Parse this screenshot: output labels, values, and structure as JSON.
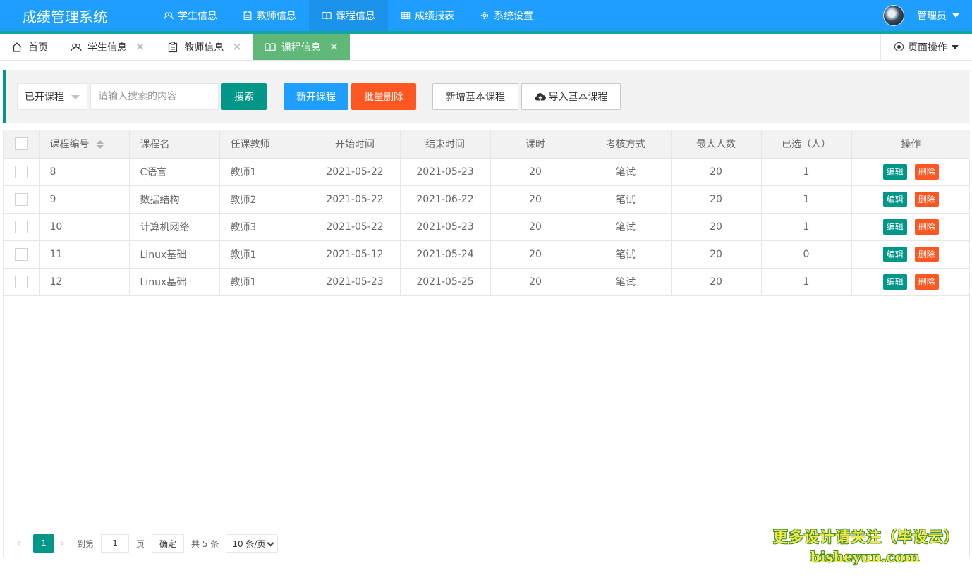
{
  "app": {
    "title": "成绩管理系统"
  },
  "nav": {
    "items": [
      {
        "label": "学生信息",
        "icon": "users-icon"
      },
      {
        "label": "教师信息",
        "icon": "clipboard-icon"
      },
      {
        "label": "课程信息",
        "icon": "book-icon",
        "active": true
      },
      {
        "label": "成绩报表",
        "icon": "table-icon"
      },
      {
        "label": "系统设置",
        "icon": "gear-icon"
      }
    ]
  },
  "user": {
    "name": "管理员"
  },
  "tabs": {
    "items": [
      {
        "label": "首页",
        "icon": "home-icon",
        "closable": false
      },
      {
        "label": "学生信息",
        "icon": "users-icon",
        "closable": true
      },
      {
        "label": "教师信息",
        "icon": "clipboard-icon",
        "closable": true
      },
      {
        "label": "课程信息",
        "icon": "book-icon",
        "closable": true,
        "active": true
      }
    ],
    "close_glyph": "✕",
    "page_ops": "页面操作"
  },
  "toolbar": {
    "filter_selected": "已开课程",
    "search_placeholder": "请输入搜索的内容",
    "search_label": "搜索",
    "new_course_label": "新开课程",
    "batch_delete_label": "批量删除",
    "add_basic_label": "新增基本课程",
    "import_basic_label": "导入基本课程"
  },
  "table": {
    "headers": [
      "课程编号",
      "课程名",
      "任课教师",
      "开始时间",
      "结束时间",
      "课时",
      "考核方式",
      "最大人数",
      "已选（人）",
      "操作"
    ],
    "rows": [
      [
        "8",
        "C语言",
        "教师1",
        "2021-05-22",
        "2021-05-23",
        "20",
        "笔试",
        "20",
        "1"
      ],
      [
        "9",
        "数据结构",
        "教师2",
        "2021-05-22",
        "2021-06-22",
        "20",
        "笔试",
        "20",
        "1"
      ],
      [
        "10",
        "计算机网络",
        "教师3",
        "2021-05-22",
        "2021-05-23",
        "20",
        "笔试",
        "20",
        "1"
      ],
      [
        "11",
        "Linux基础",
        "教师1",
        "2021-05-12",
        "2021-05-24",
        "20",
        "笔试",
        "20",
        "0"
      ],
      [
        "12",
        "Linux基础",
        "教师1",
        "2021-05-23",
        "2021-05-25",
        "20",
        "笔试",
        "20",
        "1"
      ]
    ],
    "edit_label": "编辑",
    "delete_label": "删除"
  },
  "pager": {
    "current_page": "1",
    "goto_label": "到第",
    "goto_value": "1",
    "page_unit": "页",
    "confirm_label": "确定",
    "total_label": "共 5 条",
    "limit_label": "10 条/页"
  },
  "watermark": {
    "line1": "更多设计请关注（毕设云）",
    "line2": "bisheyun.com"
  },
  "colors": {
    "header_bg": "#1e9fff",
    "accent_teal": "#009688",
    "accent_green": "#5fb878",
    "danger": "#ff5722",
    "primary": "#1e9fff"
  }
}
